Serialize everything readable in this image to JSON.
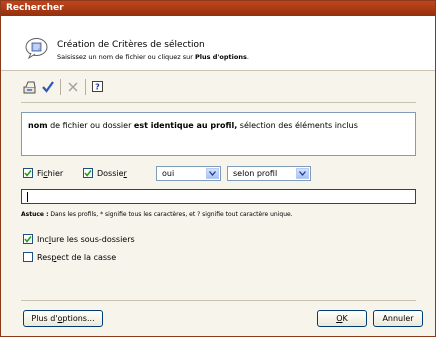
{
  "window": {
    "title": "Rechercher"
  },
  "header": {
    "title": "Création de Critères de sélection",
    "subtitle_prefix": "Saisissez un nom de fichier ou cliquez sur ",
    "subtitle_bold": "Plus d'options",
    "subtitle_suffix": "."
  },
  "toolbar": {
    "icons": [
      "open-icon",
      "checkmark-icon",
      "delete-icon",
      "help-icon"
    ]
  },
  "criteria": {
    "bold1": "nom",
    "text1": " de fichier ou dossier ",
    "bold2": "est identique au profil,",
    "text2": " sélection des éléments inclus"
  },
  "filters": {
    "fichier": {
      "pre": "Fi",
      "accel": "c",
      "post": "hier",
      "checked": true
    },
    "dossier": {
      "pre": "Dossie",
      "accel": "r",
      "post": "",
      "checked": true
    },
    "match_value": "oui",
    "mode_value": "selon profil"
  },
  "pattern_input": {
    "value": ""
  },
  "tip": {
    "label": "Astuce :",
    "text": " Dans les profils, * signifie tous les caractères, et ? signifie tout caractère unique."
  },
  "options": {
    "include_subfolders": {
      "pre": "Inc",
      "accel": "l",
      "post": "ure les sous-dossiers",
      "checked": true
    },
    "match_case": {
      "pre": "Res",
      "accel": "p",
      "post": "ect de la casse",
      "checked": false
    }
  },
  "buttons": {
    "more_pre": "Plus d'",
    "more_accel": "o",
    "more_post": "ptions...",
    "ok_accel": "O",
    "ok_post": "K",
    "cancel": "Annuler"
  },
  "colors": {
    "titlebar": "#a83a14",
    "accent": "#1c5180"
  }
}
